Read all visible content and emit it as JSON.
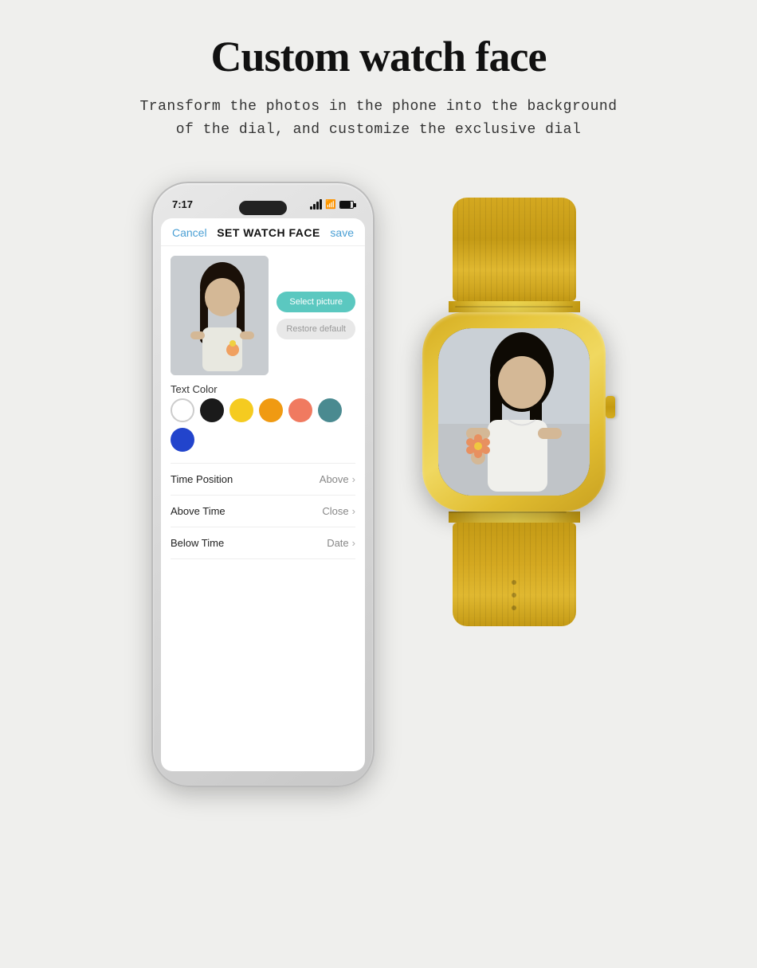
{
  "page": {
    "title": "Custom watch face",
    "subtitle_line1": "Transform the photos in the phone into the background",
    "subtitle_line2": "of the dial, and customize the exclusive dial"
  },
  "phone": {
    "time": "7:17",
    "app": {
      "cancel_label": "Cancel",
      "title_label": "SET WATCH FACE",
      "save_label": "save",
      "select_picture_label": "Select picture",
      "restore_default_label": "Restore default",
      "text_color_label": "Text Color",
      "menu_items": [
        {
          "label": "Time Position",
          "value": "Above"
        },
        {
          "label": "Above Time",
          "value": "Close"
        },
        {
          "label": "Below Time",
          "value": "Date"
        }
      ]
    }
  },
  "icons": {
    "chevron": "›",
    "wifi": "📶",
    "back": "‹"
  }
}
